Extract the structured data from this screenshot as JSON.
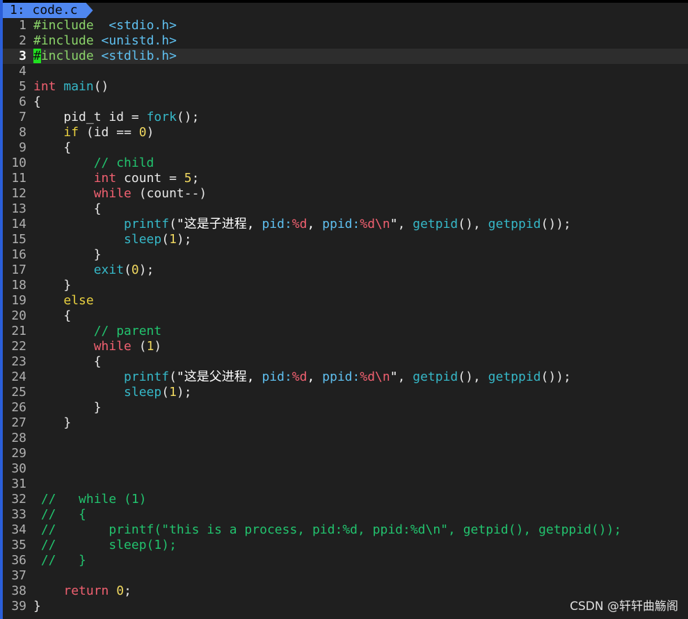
{
  "tab": {
    "label": "1: code.c"
  },
  "watermark": "CSDN @轩轩曲觞阁",
  "lines": [
    {
      "n": "1",
      "segs": [
        [
          "k-pre",
          "#include"
        ],
        [
          "k-plain",
          "  "
        ],
        [
          "k-inc",
          "<stdio.h>"
        ]
      ]
    },
    {
      "n": "2",
      "segs": [
        [
          "k-pre",
          "#include"
        ],
        [
          "k-plain",
          " "
        ],
        [
          "k-inc",
          "<unistd.h>"
        ]
      ]
    },
    {
      "n": "3",
      "cursorline": true,
      "segs": [
        [
          "cursor",
          "#"
        ],
        [
          "k-pre",
          "include"
        ],
        [
          "k-plain",
          " "
        ],
        [
          "k-inc",
          "<stdlib.h>"
        ]
      ]
    },
    {
      "n": "4",
      "segs": []
    },
    {
      "n": "5",
      "segs": [
        [
          "k-type",
          "int"
        ],
        [
          "k-plain",
          " "
        ],
        [
          "k-fn",
          "main"
        ],
        [
          "k-plain",
          "()"
        ]
      ]
    },
    {
      "n": "6",
      "segs": [
        [
          "k-plain",
          "{"
        ]
      ]
    },
    {
      "n": "7",
      "segs": [
        [
          "k-plain",
          "    pid_t id = "
        ],
        [
          "k-fn",
          "fork"
        ],
        [
          "k-plain",
          "();"
        ]
      ]
    },
    {
      "n": "8",
      "segs": [
        [
          "k-plain",
          "    "
        ],
        [
          "k-ctl",
          "if"
        ],
        [
          "k-plain",
          " (id == "
        ],
        [
          "k-num",
          "0"
        ],
        [
          "k-plain",
          ")"
        ]
      ]
    },
    {
      "n": "9",
      "segs": [
        [
          "k-plain",
          "    {"
        ]
      ]
    },
    {
      "n": "10",
      "segs": [
        [
          "k-plain",
          "        "
        ],
        [
          "k-cmt",
          "// child"
        ]
      ]
    },
    {
      "n": "11",
      "segs": [
        [
          "k-plain",
          "        "
        ],
        [
          "k-type",
          "int"
        ],
        [
          "k-plain",
          " count = "
        ],
        [
          "k-num",
          "5"
        ],
        [
          "k-plain",
          ";"
        ]
      ]
    },
    {
      "n": "12",
      "segs": [
        [
          "k-plain",
          "        "
        ],
        [
          "k-loop",
          "while"
        ],
        [
          "k-plain",
          " (count--)"
        ]
      ]
    },
    {
      "n": "13",
      "segs": [
        [
          "k-plain",
          "        {"
        ]
      ]
    },
    {
      "n": "14",
      "segs": [
        [
          "k-plain",
          "            "
        ],
        [
          "k-fn",
          "printf"
        ],
        [
          "k-plain",
          "("
        ],
        [
          "k-str",
          "\"这是子进程, "
        ],
        [
          "k-strn",
          "pid:"
        ],
        [
          "k-fmt",
          "%d"
        ],
        [
          "k-str",
          ", "
        ],
        [
          "k-strn",
          "ppid:"
        ],
        [
          "k-fmt",
          "%d\\n"
        ],
        [
          "k-str",
          "\""
        ],
        [
          "k-plain",
          ", "
        ],
        [
          "k-fn",
          "getpid"
        ],
        [
          "k-plain",
          "(), "
        ],
        [
          "k-fn",
          "getppid"
        ],
        [
          "k-plain",
          "());"
        ]
      ]
    },
    {
      "n": "15",
      "segs": [
        [
          "k-plain",
          "            "
        ],
        [
          "k-fn",
          "sleep"
        ],
        [
          "k-plain",
          "("
        ],
        [
          "k-num",
          "1"
        ],
        [
          "k-plain",
          ");"
        ]
      ]
    },
    {
      "n": "16",
      "segs": [
        [
          "k-plain",
          "        }"
        ]
      ]
    },
    {
      "n": "17",
      "segs": [
        [
          "k-plain",
          "        "
        ],
        [
          "k-fn",
          "exit"
        ],
        [
          "k-plain",
          "("
        ],
        [
          "k-num",
          "0"
        ],
        [
          "k-plain",
          ");"
        ]
      ]
    },
    {
      "n": "18",
      "segs": [
        [
          "k-plain",
          "    }"
        ]
      ]
    },
    {
      "n": "19",
      "segs": [
        [
          "k-plain",
          "    "
        ],
        [
          "k-ctl",
          "else"
        ]
      ]
    },
    {
      "n": "20",
      "segs": [
        [
          "k-plain",
          "    {"
        ]
      ]
    },
    {
      "n": "21",
      "segs": [
        [
          "k-plain",
          "        "
        ],
        [
          "k-cmt",
          "// parent"
        ]
      ]
    },
    {
      "n": "22",
      "segs": [
        [
          "k-plain",
          "        "
        ],
        [
          "k-loop",
          "while"
        ],
        [
          "k-plain",
          " ("
        ],
        [
          "k-num",
          "1"
        ],
        [
          "k-plain",
          ")"
        ]
      ]
    },
    {
      "n": "23",
      "segs": [
        [
          "k-plain",
          "        {"
        ]
      ]
    },
    {
      "n": "24",
      "segs": [
        [
          "k-plain",
          "            "
        ],
        [
          "k-fn",
          "printf"
        ],
        [
          "k-plain",
          "("
        ],
        [
          "k-str",
          "\"这是父进程, "
        ],
        [
          "k-strn",
          "pid:"
        ],
        [
          "k-fmt",
          "%d"
        ],
        [
          "k-str",
          ", "
        ],
        [
          "k-strn",
          "ppid:"
        ],
        [
          "k-fmt",
          "%d\\n"
        ],
        [
          "k-str",
          "\""
        ],
        [
          "k-plain",
          ", "
        ],
        [
          "k-fn",
          "getpid"
        ],
        [
          "k-plain",
          "(), "
        ],
        [
          "k-fn",
          "getppid"
        ],
        [
          "k-plain",
          "());"
        ]
      ]
    },
    {
      "n": "25",
      "segs": [
        [
          "k-plain",
          "            "
        ],
        [
          "k-fn",
          "sleep"
        ],
        [
          "k-plain",
          "("
        ],
        [
          "k-num",
          "1"
        ],
        [
          "k-plain",
          ");"
        ]
      ]
    },
    {
      "n": "26",
      "segs": [
        [
          "k-plain",
          "        }"
        ]
      ]
    },
    {
      "n": "27",
      "segs": [
        [
          "k-plain",
          "    }"
        ]
      ]
    },
    {
      "n": "28",
      "segs": []
    },
    {
      "n": "29",
      "segs": []
    },
    {
      "n": "30",
      "segs": []
    },
    {
      "n": "31",
      "segs": []
    },
    {
      "n": "32",
      "segs": [
        [
          "k-cmt",
          " //   while (1)"
        ]
      ]
    },
    {
      "n": "33",
      "segs": [
        [
          "k-cmt",
          " //   {"
        ]
      ]
    },
    {
      "n": "34",
      "segs": [
        [
          "k-cmt",
          " //       printf(\"this is a process, pid:%d, ppid:%d\\n\", getpid(), getppid());"
        ]
      ]
    },
    {
      "n": "35",
      "segs": [
        [
          "k-cmt",
          " //       sleep(1);"
        ]
      ]
    },
    {
      "n": "36",
      "segs": [
        [
          "k-cmt",
          " //   }"
        ]
      ]
    },
    {
      "n": "37",
      "segs": []
    },
    {
      "n": "38",
      "segs": [
        [
          "k-plain",
          "    "
        ],
        [
          "k-ret",
          "return"
        ],
        [
          "k-plain",
          " "
        ],
        [
          "k-num",
          "0"
        ],
        [
          "k-plain",
          ";"
        ]
      ]
    },
    {
      "n": "39",
      "segs": [
        [
          "k-plain",
          "}"
        ]
      ]
    }
  ]
}
